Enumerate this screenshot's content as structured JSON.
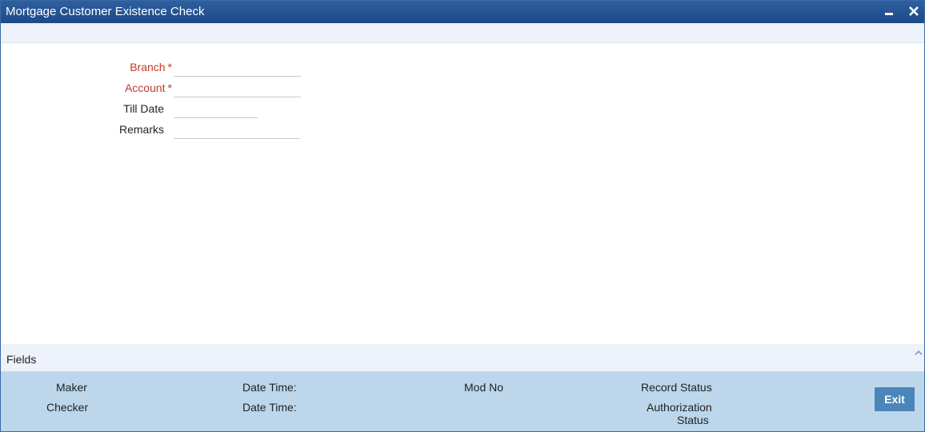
{
  "window": {
    "title": "Mortgage Customer Existence Check",
    "controls": {
      "minimize": "minimize-icon",
      "close": "close-icon"
    }
  },
  "form": {
    "branch_label": "Branch",
    "account_label": "Account",
    "till_date_label": "Till Date",
    "remarks_label": "Remarks",
    "required_mark": "*",
    "branch_value": "",
    "account_value": "",
    "till_date_value": "",
    "remarks_value": ""
  },
  "fields_bar": {
    "label": "Fields",
    "toggle_icon": "chevron-up-icon"
  },
  "audit": {
    "maker": "Maker",
    "checker": "Checker",
    "date_time_1": "Date Time:",
    "date_time_2": "Date Time:",
    "mod_no": "Mod No",
    "record_status": "Record Status",
    "authorization": "Authorization",
    "status": "Status"
  },
  "buttons": {
    "exit": "Exit"
  },
  "colors": {
    "title_bar": "#2a5896",
    "required": "#c0392b",
    "audit_bg": "#bcd7ec",
    "exit_button": "#4a86b8"
  }
}
